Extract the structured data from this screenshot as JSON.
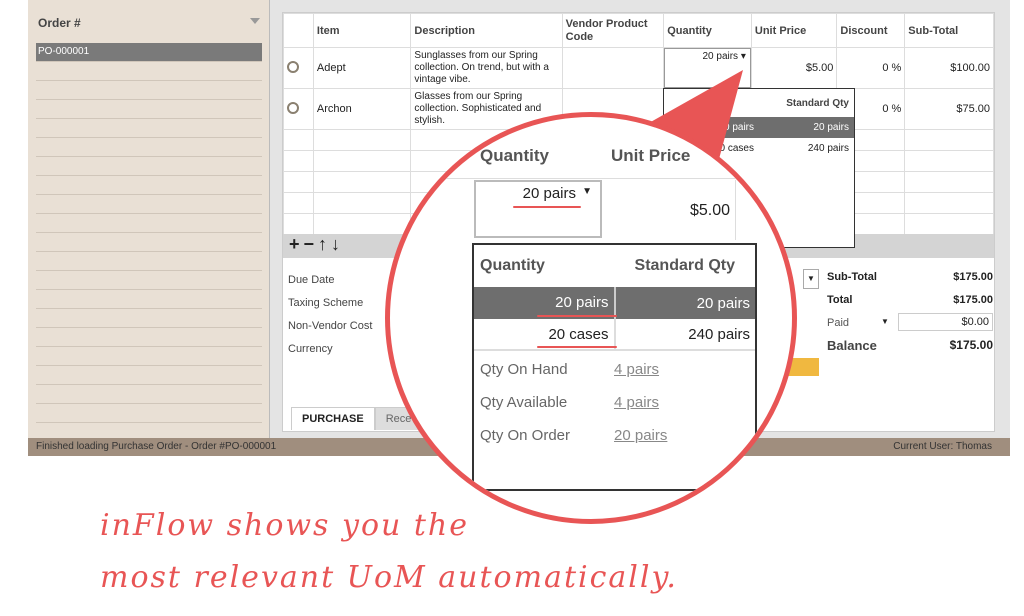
{
  "sidebar": {
    "header": "Order #",
    "items": [
      "PO-000001"
    ]
  },
  "table": {
    "columns": [
      "Item",
      "Description",
      "Vendor Product Code",
      "Quantity",
      "Unit Price",
      "Discount",
      "Sub-Total"
    ],
    "rows": [
      {
        "item": "Adept",
        "description": "Sunglasses from our Spring collection. On trend, but with a vintage vibe.",
        "vendor_code": "",
        "quantity": "20 pairs",
        "unit_price": "$5.00",
        "discount": "0 %",
        "subtotal": "$100.00"
      },
      {
        "item": "Archon",
        "description": "Glasses from our Spring collection. Sophisticated and stylish.",
        "vendor_code": "",
        "quantity": "",
        "unit_price": "",
        "discount": "0 %",
        "subtotal": "$75.00"
      }
    ]
  },
  "toolbar": {
    "add": "+",
    "remove": "−",
    "up": "↑",
    "down": "↓"
  },
  "form": {
    "due_date": "Due Date",
    "taxing_scheme": "Taxing Scheme",
    "non_vendor_cost": "Non-Vendor Cost",
    "currency": "Currency"
  },
  "totals": {
    "subtotal_label": "Sub-Total",
    "subtotal": "$175.00",
    "total_label": "Total",
    "total": "$175.00",
    "paid_label": "Paid",
    "paid": "$0.00",
    "balance_label": "Balance",
    "balance": "$175.00"
  },
  "tabs": [
    "PURCHASE",
    "Rece"
  ],
  "status": {
    "message": "Finished loading Purchase Order - Order #PO-000001",
    "user": "Current User:  Thomas"
  },
  "uom_dropdown": {
    "headers": [
      "Quantity",
      "Standard Qty"
    ],
    "rows": [
      [
        "20 pairs",
        "20 pairs"
      ],
      [
        "20 cases",
        "240 pairs"
      ]
    ],
    "stock": [
      {
        "label": "Qty On Hand",
        "value": "4 pairs"
      },
      {
        "label": "Qty Available",
        "value": "4 pairs"
      },
      {
        "label": "Qty On Order",
        "value": "20 pairs"
      }
    ]
  },
  "magnifier": {
    "quantity_header": "Quantity",
    "unit_price_header": "Unit Price",
    "quantity": "20 pairs",
    "unit_price": "$5.00"
  },
  "caption": {
    "line1": "inFlow shows you the",
    "line2": "most relevant UoM automatically."
  },
  "colors": {
    "accent": "#e85555",
    "selected_row": "#6e6e6e",
    "status_bar": "#a08e7e",
    "sidebar": "#e9e0d5"
  }
}
